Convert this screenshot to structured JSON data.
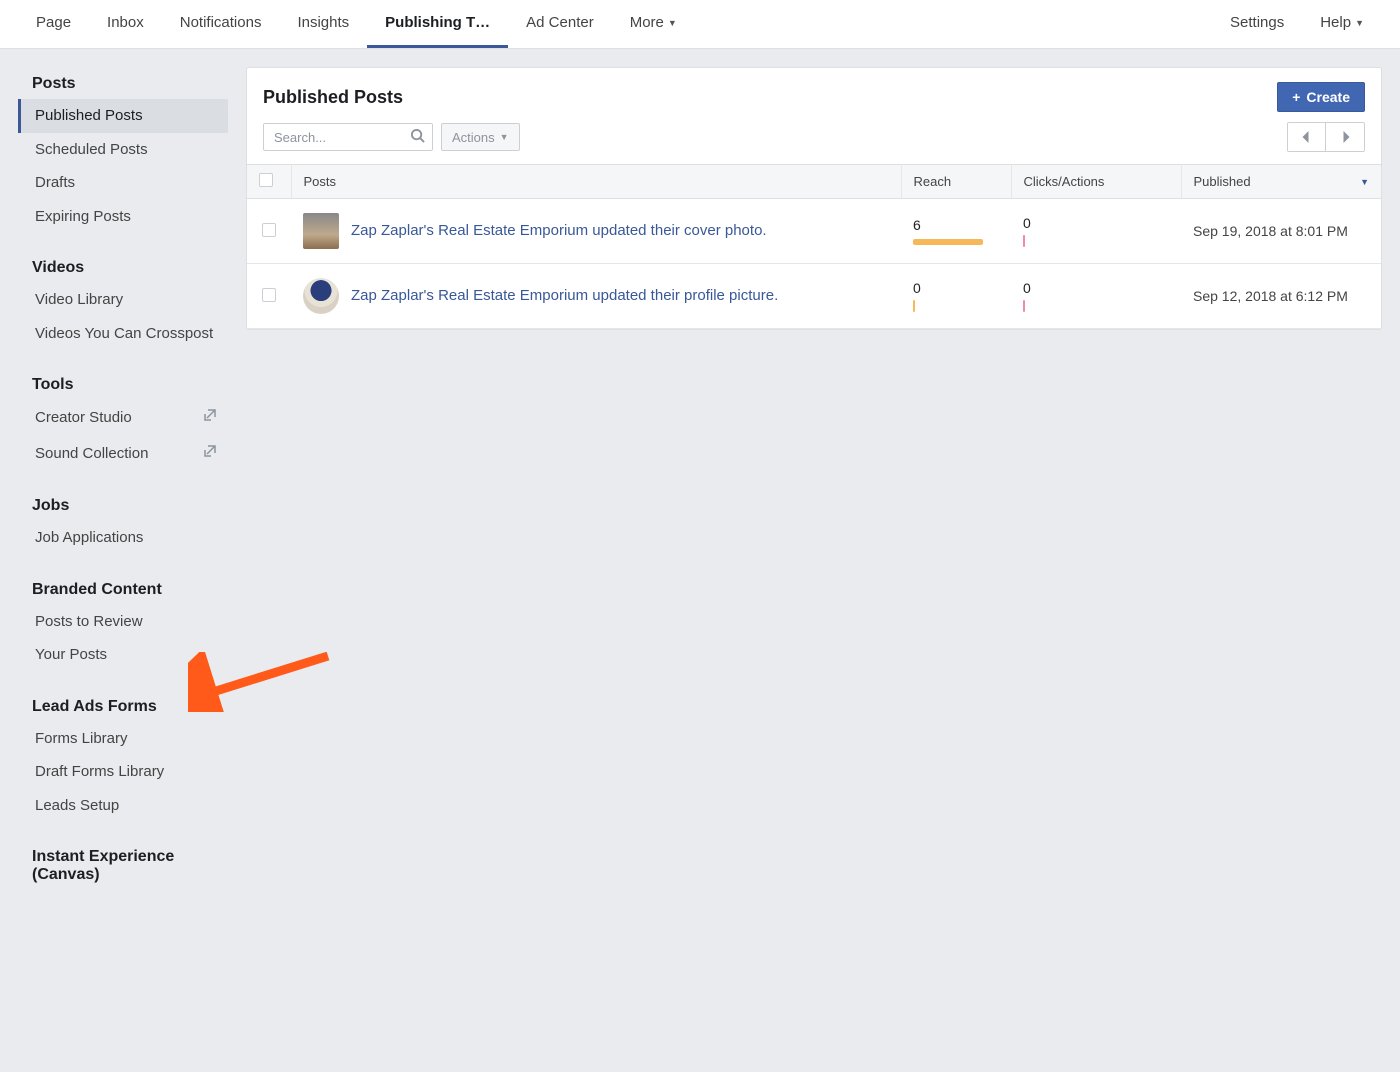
{
  "topnav": {
    "left": [
      "Page",
      "Inbox",
      "Notifications",
      "Insights",
      "Publishing T…",
      "Ad Center",
      "More"
    ],
    "activeIndex": 4,
    "right": [
      "Settings",
      "Help"
    ]
  },
  "sidebar": {
    "sections": [
      {
        "title": "Posts",
        "items": [
          "Published Posts",
          "Scheduled Posts",
          "Drafts",
          "Expiring Posts"
        ],
        "selectedIndex": 0
      },
      {
        "title": "Videos",
        "items": [
          "Video Library",
          "Videos You Can Crosspost"
        ]
      },
      {
        "title": "Tools",
        "items": [
          "Creator Studio",
          "Sound Collection"
        ],
        "external": [
          true,
          true
        ]
      },
      {
        "title": "Jobs",
        "items": [
          "Job Applications"
        ]
      },
      {
        "title": "Branded Content",
        "items": [
          "Posts to Review",
          "Your Posts"
        ]
      },
      {
        "title": "Lead Ads Forms",
        "items": [
          "Forms Library",
          "Draft Forms Library",
          "Leads Setup"
        ]
      },
      {
        "title": "Instant Experience (Canvas)",
        "items": []
      }
    ]
  },
  "main": {
    "title": "Published Posts",
    "createLabel": "Create",
    "searchPlaceholder": "Search...",
    "actionsLabel": "Actions",
    "columns": {
      "posts": "Posts",
      "reach": "Reach",
      "clicks": "Clicks/Actions",
      "published": "Published"
    },
    "rows": [
      {
        "text": "Zap Zaplar's Real Estate Emporium updated their cover photo.",
        "reach": "6",
        "clicks": "0",
        "date": "Sep 19, 2018 at 8:01 PM",
        "thumb": "cover"
      },
      {
        "text": "Zap Zaplar's Real Estate Emporium updated their profile picture.",
        "reach": "0",
        "clicks": "0",
        "date": "Sep 12, 2018 at 6:12 PM",
        "thumb": "avatar"
      }
    ]
  }
}
